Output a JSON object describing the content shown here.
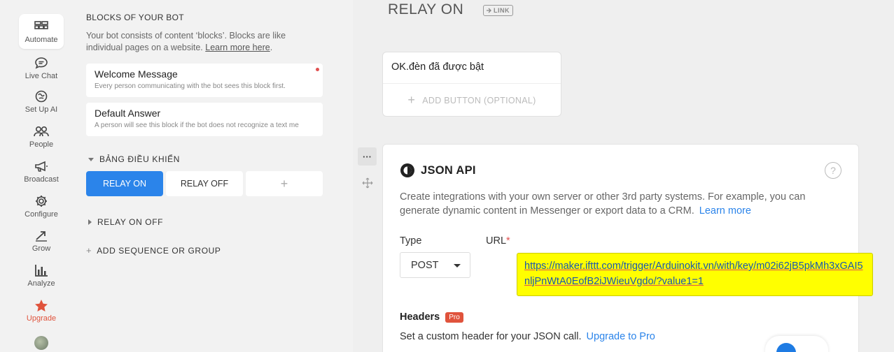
{
  "nav": {
    "items": [
      {
        "label": "Automate",
        "icon": "automate-icon"
      },
      {
        "label": "Live Chat",
        "icon": "chat-bubble-icon"
      },
      {
        "label": "Set Up AI",
        "icon": "ai-brain-icon"
      },
      {
        "label": "People",
        "icon": "people-icon"
      },
      {
        "label": "Broadcast",
        "icon": "megaphone-icon"
      },
      {
        "label": "Configure",
        "icon": "gear-icon"
      },
      {
        "label": "Grow",
        "icon": "grow-arrow-icon"
      },
      {
        "label": "Analyze",
        "icon": "bar-chart-icon"
      },
      {
        "label": "Upgrade",
        "icon": "star-icon"
      }
    ]
  },
  "blocks": {
    "title": "BLOCKS OF YOUR BOT",
    "description": "Your bot consists of content ‘blocks’. Blocks are like individual pages on a website.",
    "learn_more": "Learn more here",
    "welcome": {
      "title": "Welcome Message",
      "subtitle": "Every person communicating with the bot sees this block first."
    },
    "default_answer": {
      "title": "Default Answer",
      "subtitle": "A person will see this block if the bot does not recognize a text me"
    },
    "group1": {
      "title": "BẢNG ĐIỀU KHIỂN",
      "buttons": [
        "RELAY ON",
        "RELAY OFF"
      ],
      "add": "+"
    },
    "group2": {
      "title": "RELAY ON OFF"
    },
    "add_sequence": "ADD SEQUENCE OR GROUP"
  },
  "editor": {
    "title": "RELAY ON",
    "link_badge": "LINK",
    "text_card": {
      "message": "OK.đèn đã được bật",
      "add_button": "ADD BUTTON (OPTIONAL)"
    },
    "tools": {
      "more": "···"
    },
    "json_api": {
      "title": "JSON API",
      "help": "?",
      "description": "Create integrations with your own server or other 3rd party systems. For example, you can generate dynamic content in Messenger or export data to a CRM.",
      "learn_more": "Learn more",
      "type_label": "Type",
      "type_value": "POST",
      "url_label": "URL",
      "url_required": "*",
      "url_value": "https://maker.ifttt.com/trigger/Arduinokit.vn/with/key/m02i62jB5pkMh3xGAI5nljPnWtA0EofB2iJWieuVgdo/?value1=1",
      "headers_label": "Headers",
      "pro_badge": "Pro",
      "headers_desc": "Set a custom header for your JSON call.",
      "upgrade_link": "Upgrade to Pro"
    }
  },
  "colors": {
    "accent": "#2b84ea",
    "upgrade": "#e0533c",
    "url_highlight": "#ffff00"
  }
}
